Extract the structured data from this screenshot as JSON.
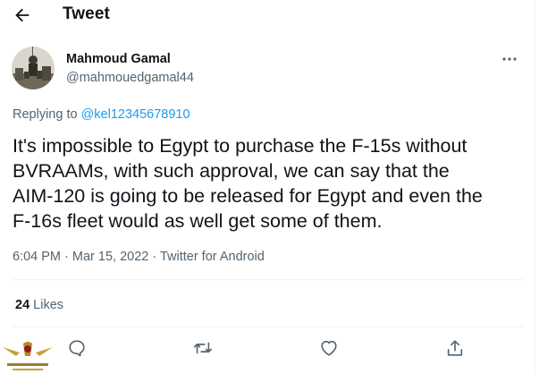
{
  "header": {
    "title": "Tweet",
    "back_icon": "arrow-left-icon"
  },
  "tweet": {
    "author_name": "Mahmoud Gamal",
    "author_handle": "@mahmouedgamal44",
    "replying_prefix": "Replying to",
    "replying_to": "@kel12345678910",
    "text": "It's impossible to Egypt to purchase the F-15s without\nBVRAAMs, with such approval, we can say that the\nAIM-120 is going to be released for Egypt and even the\nF-16s fleet would as well get some of them.",
    "timestamp": "6:04 PM · Mar 15, 2022 · Twitter for Android",
    "likes_count": "24",
    "likes_label": "Likes"
  },
  "actions": [
    "reply-icon",
    "retweet-icon",
    "like-icon",
    "share-icon"
  ],
  "colors": {
    "accent": "#1d9bf0",
    "secondary_text": "#536471",
    "divider": "#eff3f4"
  }
}
